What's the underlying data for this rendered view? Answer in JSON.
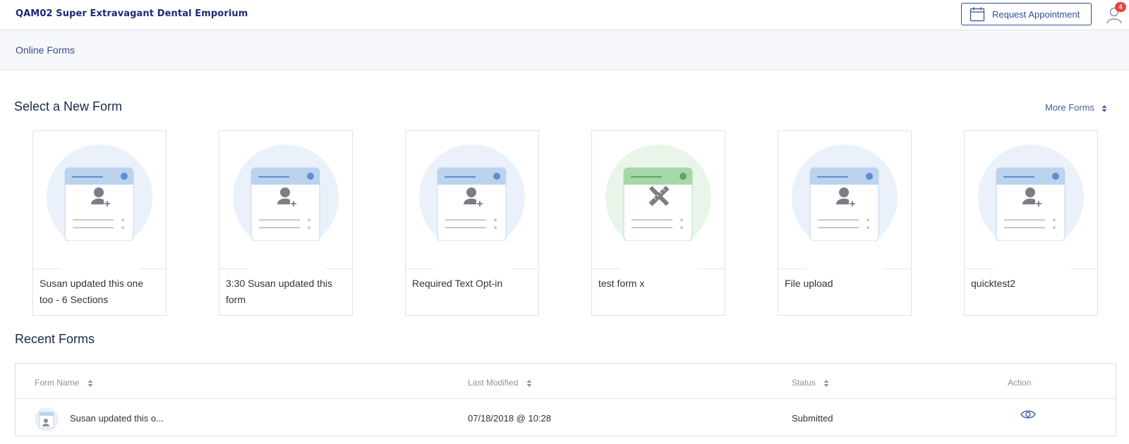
{
  "header": {
    "brand": "QAM02 Super Extravagant Dental Emporium",
    "request_button_label": "Request Appointment",
    "notification_count": "4"
  },
  "breadcrumb": "Online Forms",
  "new_forms": {
    "title": "Select a New Form",
    "more_forms_label": "More Forms",
    "cards": [
      {
        "label": "Susan updated this one too - 6 Sections",
        "icon": "add-user-icon",
        "theme": "blue"
      },
      {
        "label": "3:30 Susan updated this form",
        "icon": "add-user-icon",
        "theme": "blue"
      },
      {
        "label": "Required Text Opt-in",
        "icon": "add-user-icon",
        "theme": "blue"
      },
      {
        "label": "test form x",
        "icon": "pencil-ruler-icon",
        "theme": "green"
      },
      {
        "label": "File upload",
        "icon": "add-user-icon",
        "theme": "blue"
      },
      {
        "label": "quicktest2",
        "icon": "add-user-icon",
        "theme": "blue"
      }
    ]
  },
  "recent_forms": {
    "title": "Recent Forms",
    "columns": [
      "Form Name",
      "Last Modified",
      "Status",
      "Action"
    ],
    "rows": [
      {
        "form_name": "Susan updated this o...",
        "last_modified": "07/18/2018 @ 10:28",
        "status": "Submitted",
        "action": "view-icon"
      }
    ]
  },
  "colors": {
    "brand": "#1e2a78",
    "accent": "#2b4e9b",
    "badge": "#e8463c",
    "card_blue_bg": "#eaf1fa",
    "card_green_bg": "#eaf5ea"
  }
}
